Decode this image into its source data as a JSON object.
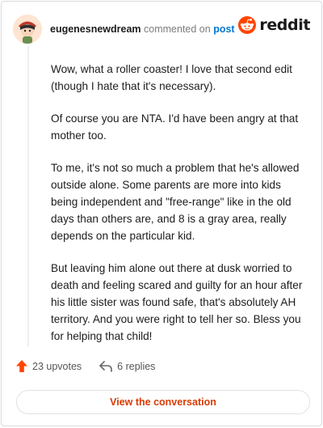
{
  "header": {
    "username": "eugenesnewdream",
    "commented_text": "commented on",
    "post_link": "post",
    "brand_wordmark": "reddit"
  },
  "comment": {
    "paragraphs": [
      "Wow, what a roller coaster! I love that second edit (though I hate that it's necessary).",
      "Of course you are NTA. I'd have been angry at that mother too.",
      "To me, it's not so much a problem that he's allowed outside alone. Some parents are more into kids being independent and \"free-range\" like in the old days than others are, and 8 is a gray area, really depends on the particular kid.",
      "But leaving him alone out there at dusk worried to death and feeling scared and guilty for an hour after his little sister was found safe, that's absolutely AH territory. And you were right to tell her so. Bless you for helping that child!"
    ]
  },
  "actions": {
    "upvotes": "23 upvotes",
    "replies": "6 replies"
  },
  "footer": {
    "conversation_button": "View the conversation"
  },
  "icons": {
    "avatar": "avatar-icon",
    "reddit_logo": "reddit-logo-icon",
    "upvote": "upvote-arrow-icon",
    "reply": "reply-arrow-icon"
  },
  "colors": {
    "brand": "#ff4500",
    "link": "#0079d3",
    "button_text": "#d93a00"
  }
}
